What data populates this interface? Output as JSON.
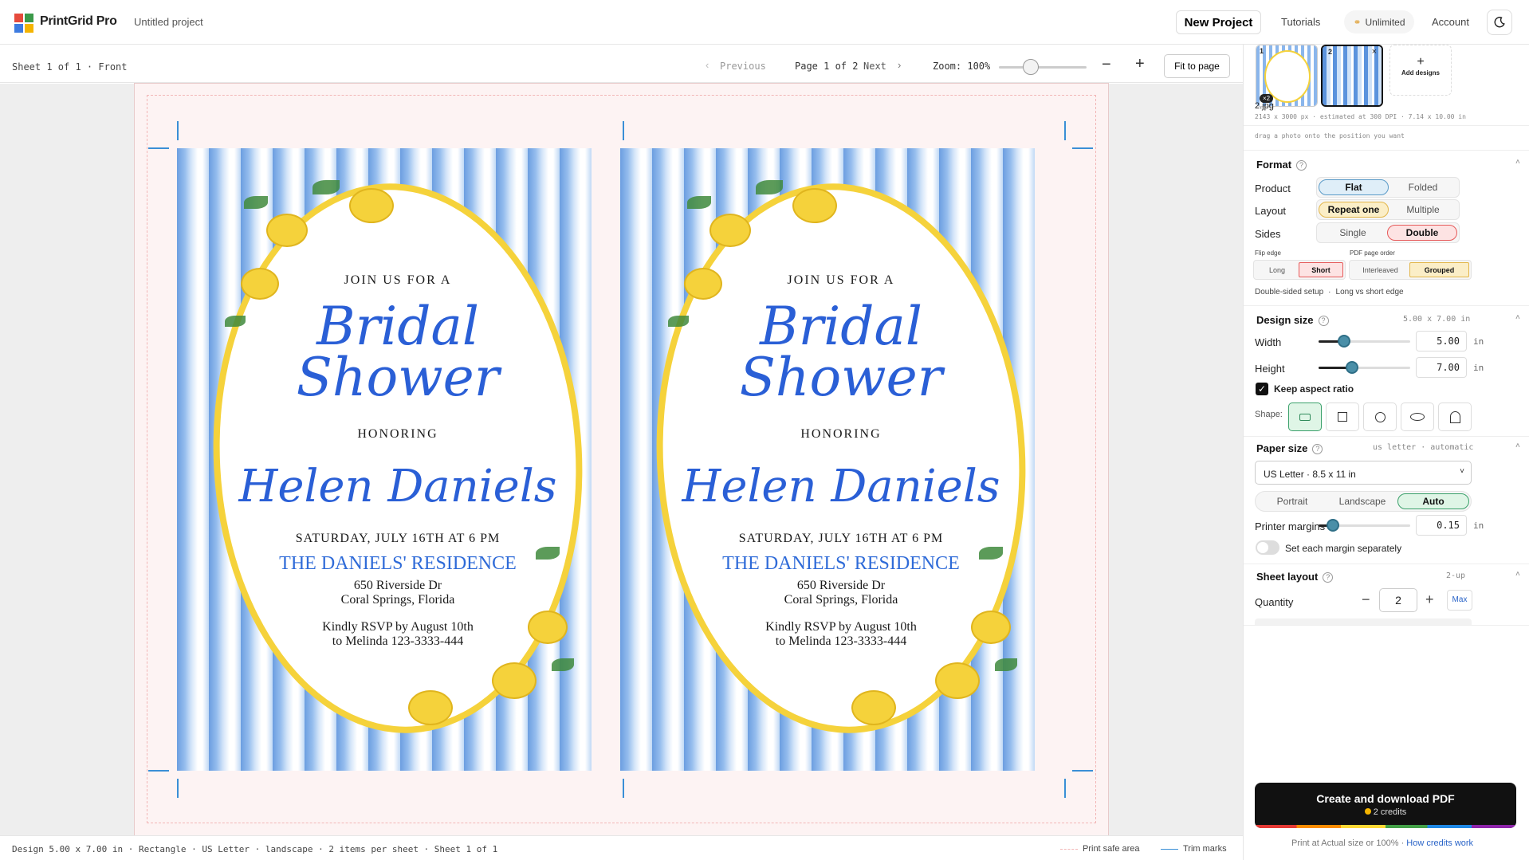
{
  "app": {
    "brand": "PrintGrid Pro",
    "project_name": "Untitled project",
    "logo_colors": [
      "#e64a3c",
      "#3b9a4a",
      "#3d7be0",
      "#f4b400"
    ]
  },
  "header": {
    "new_project": "New Project",
    "tutorials": "Tutorials",
    "unlimited": "Unlimited",
    "account": "Account"
  },
  "toolbar": {
    "sheet_info": "Sheet 1 of 1 · Front",
    "previous": "Previous",
    "page_of": "Page 1 of 2",
    "next": "Next",
    "zoom": "Zoom: 100%",
    "fit_page": "Fit to page"
  },
  "invitation": {
    "join": "JOIN US FOR A",
    "title_line1": "Bridal",
    "title_line2": "Shower",
    "honoring": "HONORING",
    "name": "Helen Daniels",
    "date": "SATURDAY, JULY 16TH AT 6 PM",
    "residence": "THE DANIELS' RESIDENCE",
    "address1": "650 Riverside Dr",
    "address2": "Coral Springs, Florida",
    "rsvp1": "Kindly RSVP by August 10th",
    "rsvp2": "to Melinda 123-3333-444"
  },
  "panel": {
    "thumbs": [
      {
        "number": "1",
        "badge": "×2"
      },
      {
        "number": "2",
        "close": "×"
      }
    ],
    "add_designs": "Add designs",
    "file_name": "2.jpg",
    "file_meta": "2143 x 3000 px · estimated at 300 DPI · 7.14 x 10.00 in",
    "drag_hint": "drag a photo onto the position you want",
    "format": {
      "title": "Format",
      "product_label": "Product",
      "product_options": [
        "Flat",
        "Folded"
      ],
      "layout_label": "Layout",
      "layout_options": [
        "Repeat one",
        "Multiple"
      ],
      "sides_label": "Sides",
      "sides_options": [
        "Single",
        "Double"
      ],
      "flip_label": "Flip edge",
      "flip_options": [
        "Long",
        "Short"
      ],
      "order_label": "PDF page order",
      "order_options": [
        "Interleaved",
        "Grouped"
      ],
      "setup_note": "Double-sided setup",
      "setup_note2": "Long vs short edge"
    },
    "design_size": {
      "title": "Design size",
      "summary": "5.00 x 7.00 in",
      "width_label": "Width",
      "width_value": "5.00",
      "height_label": "Height",
      "height_value": "7.00",
      "unit": "in",
      "keep_aspect": "Keep aspect ratio",
      "shape_label": "Shape:",
      "shapes": [
        "rounded-rectangle-icon",
        "square-icon",
        "circle-icon",
        "ellipse-icon",
        "arch-icon"
      ]
    },
    "paper_size": {
      "title": "Paper size",
      "summary": "us letter · automatic",
      "selected": "US Letter · 8.5 x 11 in",
      "orientation_options": [
        "Portrait",
        "Landscape",
        "Auto"
      ],
      "margins_label": "Printer margins",
      "margins_value": "0.15",
      "unit": "in",
      "separate_label": "Set each margin separately"
    },
    "sheet_layout": {
      "title": "Sheet layout",
      "summary": "2-up",
      "quantity_label": "Quantity",
      "quantity_value": "2",
      "max": "Max"
    },
    "create": {
      "label": "Create and download PDF",
      "credits": "2 credits"
    },
    "print_note": "Print at Actual size or 100% ·",
    "credits_link": "How credits work"
  },
  "footer": {
    "status": "Design 5.00 x 7.00 in · Rectangle · US Letter · landscape · 2 items per sheet · Sheet 1 of 1",
    "safe_area": "Print safe area",
    "trim_marks": "Trim marks"
  },
  "colors": {
    "accent_blue": "#2a5fd6",
    "lemon_yellow": "#f5d23b",
    "selected_blue_bg": "#dfeef8",
    "selected_yellow_bg": "#fbeec7",
    "selected_red_bg": "#fde3e3",
    "selected_green_bg": "#dff5e6"
  }
}
